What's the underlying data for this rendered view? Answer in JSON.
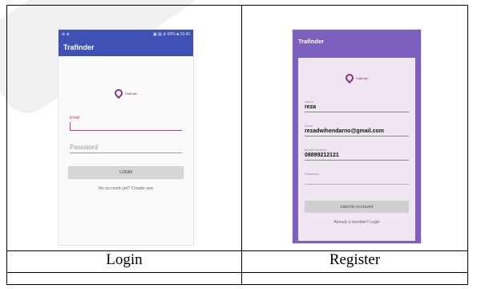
{
  "login": {
    "status_bar_left": "⊕ ⊕",
    "status_bar_right": "▣ ▤ ⇵ 60% ■ 15:40",
    "app_title": "Trafinder",
    "logo_text": "Trafinder",
    "email_label": "Email",
    "password_placeholder": "Password",
    "login_button": "LOGIN",
    "create_link": "No account yet? Create one",
    "caption": "Login"
  },
  "register": {
    "app_title": "Trafinder",
    "logo_text": "Trafinder",
    "name_label": "Nama",
    "name_value": "reza",
    "email_label": "Email",
    "email_value": "rezadwihendarno@gmail.com",
    "mobile_label": "Mobile Number",
    "mobile_value": "08899212121",
    "password_label": "Password",
    "create_button": "CREATE ACCOUNT",
    "login_link": "Already a member? Login",
    "caption": "Register"
  },
  "colors": {
    "primary": "#3f51b5",
    "accent": "#d0306f",
    "register_bg": "#7c5fbf",
    "card_bg": "#efe6f1"
  }
}
